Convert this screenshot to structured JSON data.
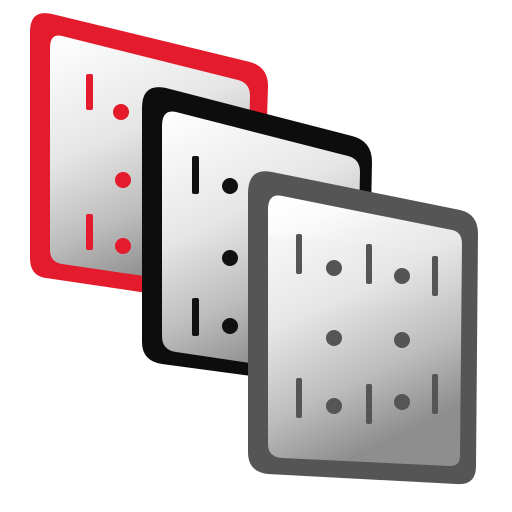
{
  "icon": {
    "name": "layered-panels-icon",
    "description_kind": "app-icon",
    "layers": [
      {
        "name": "back-panel",
        "frame_color": "#e31b2c"
      },
      {
        "name": "middle-panel",
        "frame_color": "#0d0d0d"
      },
      {
        "name": "front-panel",
        "frame_color": "#555555"
      }
    ],
    "face_gradient": [
      "#ffffff",
      "#d9d9d9",
      "#9e9e9e"
    ],
    "mark_color_back": "#e31b2c",
    "mark_color_middle": "#111111",
    "mark_color_front": "#555555"
  }
}
